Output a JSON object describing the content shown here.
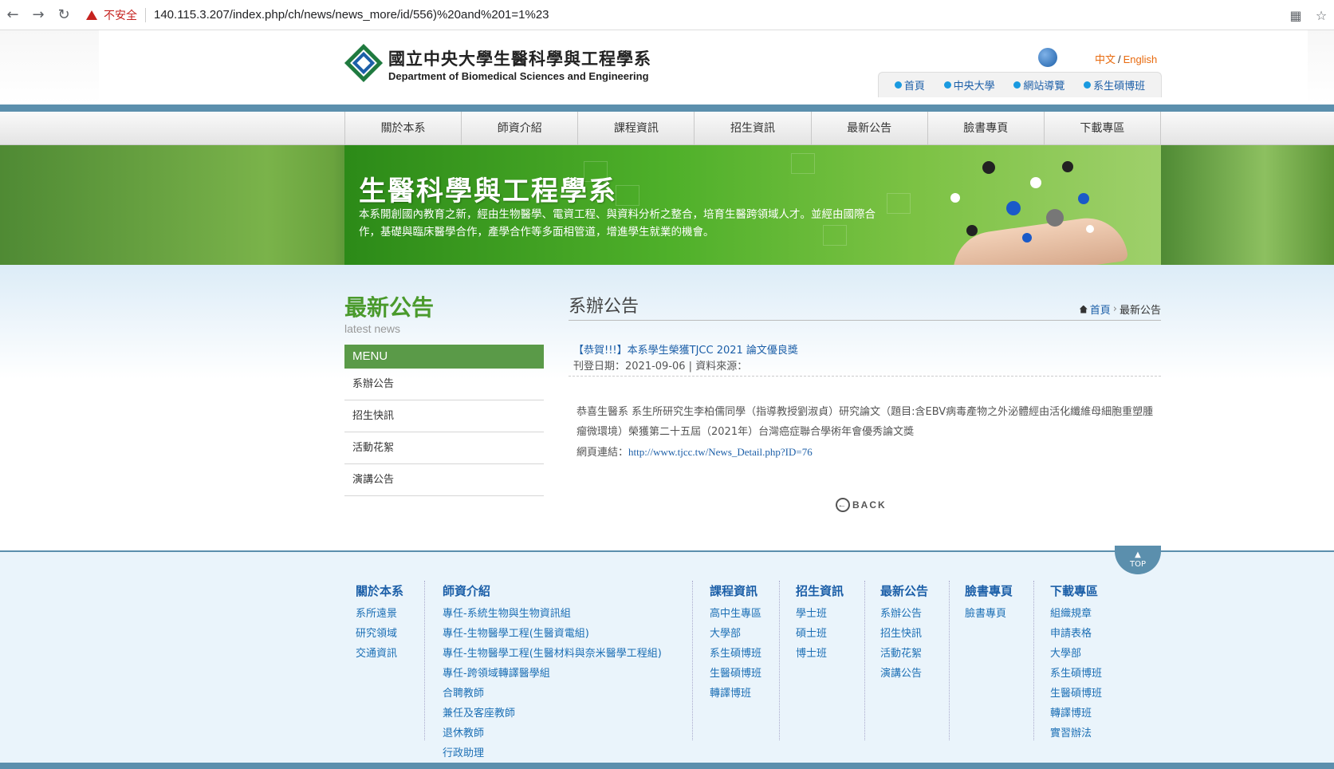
{
  "browser": {
    "warning_label": "不安全",
    "url": "140.115.3.207/index.php/ch/news/news_more/id/556)%20and%201=1%23"
  },
  "header": {
    "logo_zh": "國立中央大學生醫科學與工程學系",
    "logo_en": "Department of Biomedical Sciences and Engineering",
    "lang_zh": "中文",
    "lang_sep": "/",
    "lang_en": "English",
    "quick_links": [
      "首頁",
      "中央大學",
      "網站導覽",
      "系生碩博班"
    ]
  },
  "nav": [
    "關於本系",
    "師資介紹",
    "課程資訊",
    "招生資訊",
    "最新公告",
    "臉書專頁",
    "下載專區"
  ],
  "banner": {
    "title": "生醫科學與工程學系",
    "text": "本系開創國內教育之新，經由生物醫學、電資工程、與資料分析之整合，培育生醫跨領域人才。並經由國際合作，基礎與臨床醫學合作，產學合作等多面相管道，增進學生就業的機會。"
  },
  "sidebar": {
    "title": "最新公告",
    "subtitle": "latest news",
    "menu_label": "MENU",
    "items": [
      "系辦公告",
      "招生快訊",
      "活動花絮",
      "演講公告"
    ]
  },
  "main": {
    "page_title": "系辦公告",
    "breadcrumb_home": "首頁",
    "breadcrumb_sep": "›",
    "breadcrumb_current": "最新公告",
    "news_title": "【恭賀!!!】本系學生榮獲TJCC 2021 論文優良獎",
    "meta": "刊登日期：2021-09-06 | 資料來源：",
    "body": "恭喜生醫系 系生所研究生李柏儒同學（指導教授劉淑貞）研究論文（題目:含EBV病毒產物之外泌體經由活化纖維母細胞重塑腫瘤微環境）榮獲第二十五屆（2021年）台灣癌症聯合學術年會優秀論文獎",
    "link_label": "網頁連結：",
    "link_url": "http://www.tjcc.tw/News_Detail.php?ID=76",
    "back_label": "BACK"
  },
  "footer": {
    "top_label": "TOP",
    "columns": [
      {
        "heading": "關於本系",
        "items": [
          "系所遠景",
          "研究領域",
          "交通資訊"
        ]
      },
      {
        "heading": "師資介紹",
        "items": [
          "專任-系統生物與生物資訊組",
          "專任-生物醫學工程(生醫資電組)",
          "專任-生物醫學工程(生醫材料與奈米醫學工程組)",
          "專任-跨領域轉譯醫學組",
          "合聘教師",
          "兼任及客座教師",
          "退休教師",
          "行政助理"
        ]
      },
      {
        "heading": "課程資訊",
        "items": [
          "高中生專區",
          "大學部",
          "系生碩博班",
          "生醫碩博班",
          "轉譯博班"
        ]
      },
      {
        "heading": "招生資訊",
        "items": [
          "學士班",
          "碩士班",
          "博士班"
        ]
      },
      {
        "heading": "最新公告",
        "items": [
          "系辦公告",
          "招生快訊",
          "活動花絮",
          "演講公告"
        ]
      },
      {
        "heading": "臉書專頁",
        "items": [
          "臉書專頁"
        ]
      },
      {
        "heading": "下載專區",
        "items": [
          "組織規章",
          "申請表格",
          "大學部",
          "系生碩博班",
          "生醫碩博班",
          "轉譯博班",
          "實習辦法"
        ]
      }
    ]
  },
  "colors": {
    "accent_green": "#4a9a2c",
    "link_blue": "#1c5fa8",
    "bar_blue": "#5b8fad",
    "warning_red": "#c5221f"
  }
}
